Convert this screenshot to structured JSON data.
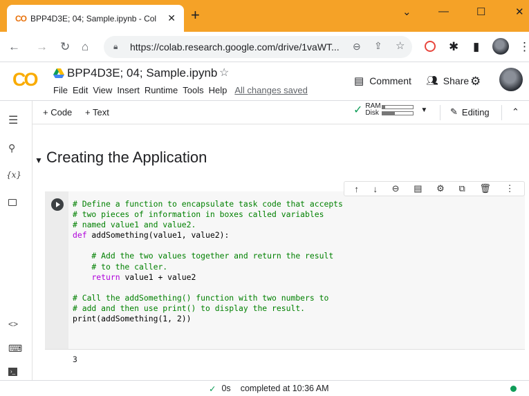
{
  "browser": {
    "tab_title": "BPP4D3E; 04; Sample.ipynb - Col",
    "tab_logo": "CO",
    "url": "https://colab.research.google.com/drive/1vaWT..."
  },
  "colab": {
    "logo": "CO",
    "notebook_title": "BPP4D3E; 04; Sample.ipynb",
    "menus": [
      "File",
      "Edit",
      "View",
      "Insert",
      "Runtime",
      "Tools",
      "Help"
    ],
    "save_status": "All changes saved",
    "comment_label": "Comment",
    "share_label": "Share"
  },
  "toolbar": {
    "add_code": "+ Code",
    "add_text": "+ Text",
    "ram_label": "RAM",
    "disk_label": "Disk",
    "editing_label": "Editing"
  },
  "sidebar": {
    "var_icon_text": "{x}"
  },
  "section_heading": "Creating the Application",
  "code_lines": [
    {
      "t": "cm",
      "s": "# Define a function to encapsulate task code that accepts"
    },
    {
      "t": "cm",
      "s": "# two pieces of information in boxes called variables"
    },
    {
      "t": "cm",
      "s": "# named value1 and value2."
    },
    {
      "t": "def",
      "kw": "def",
      "s": " addSomething(value1, value2):"
    },
    {
      "t": "blank",
      "s": ""
    },
    {
      "t": "cm",
      "s": "    # Add the two values together and return the result"
    },
    {
      "t": "cm",
      "s": "    # to the caller."
    },
    {
      "t": "ret",
      "pre": "    ",
      "kw": "return",
      "s": " value1 + value2"
    },
    {
      "t": "blank",
      "s": ""
    },
    {
      "t": "cm",
      "s": "# Call the addSomething() function with two numbers to"
    },
    {
      "t": "cm",
      "s": "# add and then use print() to display the result."
    },
    {
      "t": "plain",
      "s": "print(addSomething(1, 2))"
    }
  ],
  "output_text": "3",
  "status": {
    "time": "0s",
    "completed": "completed at 10:36 AM"
  }
}
